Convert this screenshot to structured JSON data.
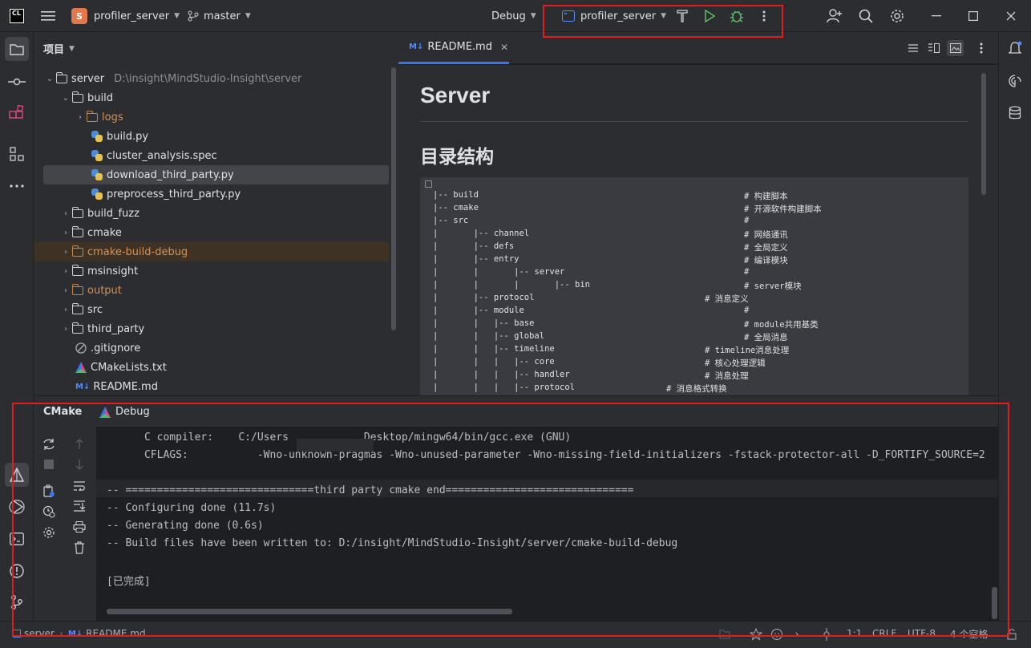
{
  "titlebar": {
    "app_logo": "CL",
    "project_badge": "S",
    "project_name": "profiler_server",
    "branch": "master",
    "run_config_mode": "Debug",
    "run_target": "profiler_server"
  },
  "project_panel": {
    "title": "项目",
    "root_name": "server",
    "root_path": "D:\\insight\\MindStudio-Insight\\server",
    "items": [
      {
        "label": "build"
      },
      {
        "label": "logs"
      },
      {
        "label": "build.py"
      },
      {
        "label": "cluster_analysis.spec"
      },
      {
        "label": "download_third_party.py"
      },
      {
        "label": "preprocess_third_party.py"
      },
      {
        "label": "build_fuzz"
      },
      {
        "label": "cmake"
      },
      {
        "label": "cmake-build-debug"
      },
      {
        "label": "msinsight"
      },
      {
        "label": "output"
      },
      {
        "label": "src"
      },
      {
        "label": "third_party"
      },
      {
        "label": ".gitignore"
      },
      {
        "label": "CMakeLists.txt"
      },
      {
        "label": "README.md"
      }
    ]
  },
  "editor": {
    "tab_label": "README.md",
    "tab_icon_text": "M↓",
    "h1": "Server",
    "h2": "目录结构",
    "code_lines": [
      {
        "text": "|-- build",
        "comment": "# 构建脚本"
      },
      {
        "text": "|-- cmake",
        "comment": "# 开源软件构建脚本"
      },
      {
        "text": "|-- src",
        "comment": "#"
      },
      {
        "text": "|       |-- channel",
        "comment": "# 网络通讯"
      },
      {
        "text": "|       |-- defs",
        "comment": "# 全局定义"
      },
      {
        "text": "|       |-- entry",
        "comment": "# 编译模块"
      },
      {
        "text": "|       |       |-- server",
        "comment": "#"
      },
      {
        "text": "|       |       |       |-- bin",
        "comment": "# server模块"
      },
      {
        "text": "|       |-- protocol",
        "comment": "# 消息定义"
      },
      {
        "text": "|       |-- module",
        "comment": "#"
      },
      {
        "text": "|       |   |-- base",
        "comment": "# module共用基类"
      },
      {
        "text": "|       |   |-- global",
        "comment": "# 全局消息"
      },
      {
        "text": "|       |   |-- timeline",
        "comment": "# timeline消息处理"
      },
      {
        "text": "|       |   |   |-- core",
        "comment": "# 核心处理逻辑"
      },
      {
        "text": "|       |   |   |-- handler",
        "comment": "# 消息处理"
      },
      {
        "text": "|       |   |   |-- protocol",
        "comment": "# 消息格式转换"
      }
    ]
  },
  "tool_window": {
    "tabs": [
      "CMake",
      "Debug"
    ],
    "console_lines": [
      "      C compiler:    C:/Users            Desktop/mingw64/bin/gcc.exe (GNU)",
      "      CFLAGS:           -Wno-unknown-pragmas -Wno-unused-parameter -Wno-missing-field-initializers -fstack-protector-all -D_FORTIFY_SOURCE=2",
      "",
      "-- ==============================third party cmake end==============================",
      "-- Configuring done (11.7s)",
      "-- Generating done (0.6s)",
      "-- Build files have been written to: D:/insight/MindStudio-Insight/server/cmake-build-debug",
      "",
      "[已完成]"
    ]
  },
  "statusbar": {
    "breadcrumb_root": "server",
    "breadcrumb_file": "README.md",
    "position": "1:1",
    "line_sep": "CRLF",
    "encoding": "UTF-8",
    "indent": "4 个空格"
  },
  "colors": {
    "background": "#1e1f22",
    "panel": "#2b2d30",
    "accent": "#3574f0",
    "run_green": "#5fb865",
    "annotation_red": "#e11d1d"
  }
}
